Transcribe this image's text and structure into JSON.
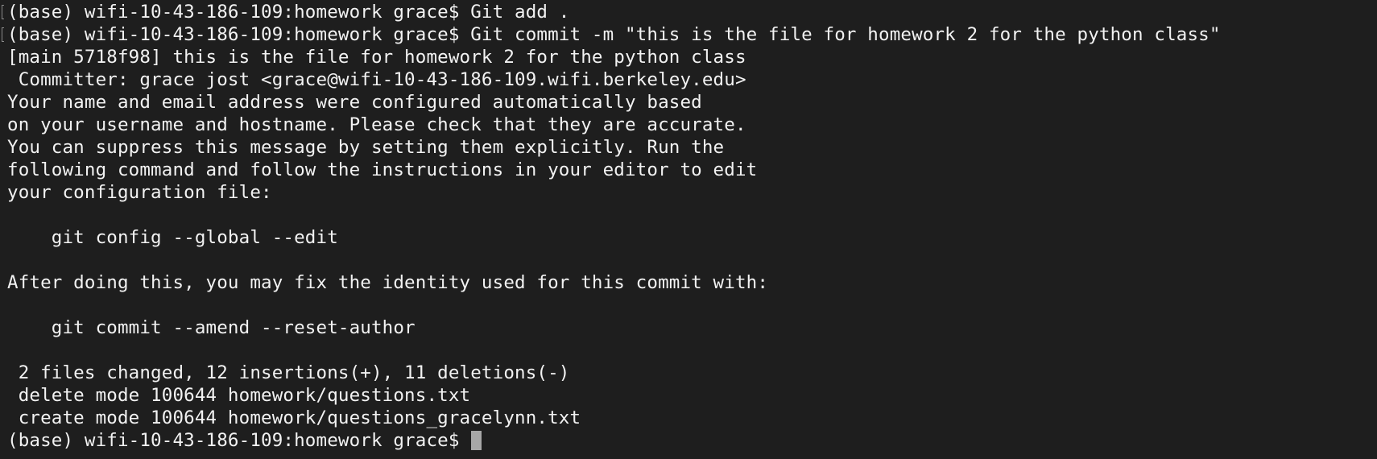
{
  "terminal": {
    "lines": [
      "(base) wifi-10-43-186-109:homework grace$ Git add .",
      "(base) wifi-10-43-186-109:homework grace$ Git commit -m \"this is the file for homework 2 for the python class\"",
      "[main 5718f98] this is the file for homework 2 for the python class",
      " Committer: grace jost <grace@wifi-10-43-186-109.wifi.berkeley.edu>",
      "Your name and email address were configured automatically based",
      "on your username and hostname. Please check that they are accurate.",
      "You can suppress this message by setting them explicitly. Run the",
      "following command and follow the instructions in your editor to edit",
      "your configuration file:",
      "",
      "    git config --global --edit",
      "",
      "After doing this, you may fix the identity used for this commit with:",
      "",
      "    git commit --amend --reset-author",
      "",
      " 2 files changed, 12 insertions(+), 11 deletions(-)",
      " delete mode 100644 homework/questions.txt",
      " create mode 100644 homework/questions_gracelynn.txt"
    ],
    "prompt": "(base) wifi-10-43-186-109:homework grace$ "
  },
  "colors": {
    "background": "#1e1e1e",
    "text": "#f2f2f2",
    "cursor": "#a7a7a7"
  }
}
